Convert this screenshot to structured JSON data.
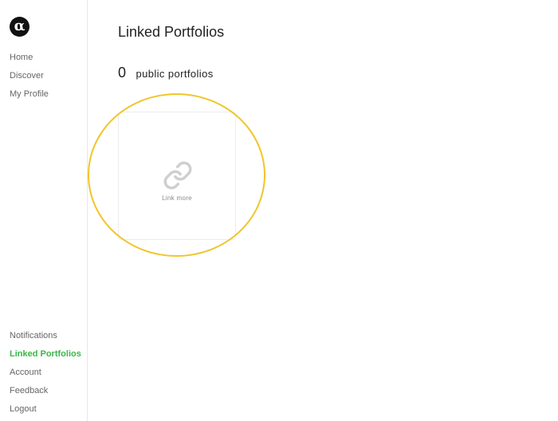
{
  "brand": {
    "logo_glyph": "α"
  },
  "sidebar": {
    "top_items": [
      {
        "label": "Home"
      },
      {
        "label": "Discover"
      },
      {
        "label": "My Profile"
      }
    ],
    "bottom_items": [
      {
        "label": "Notifications"
      },
      {
        "label": "Linked Portfolios",
        "active": true
      },
      {
        "label": "Account"
      },
      {
        "label": "Feedback"
      },
      {
        "label": "Logout"
      }
    ]
  },
  "main": {
    "title": "Linked Portfolios",
    "count": "0",
    "count_label": "public portfolios",
    "link_card": {
      "label": "Link more",
      "icon": "link-icon"
    }
  },
  "colors": {
    "active_nav": "#3cb54a",
    "highlight": "#f1c52a",
    "icon": "#cfcfcf"
  }
}
